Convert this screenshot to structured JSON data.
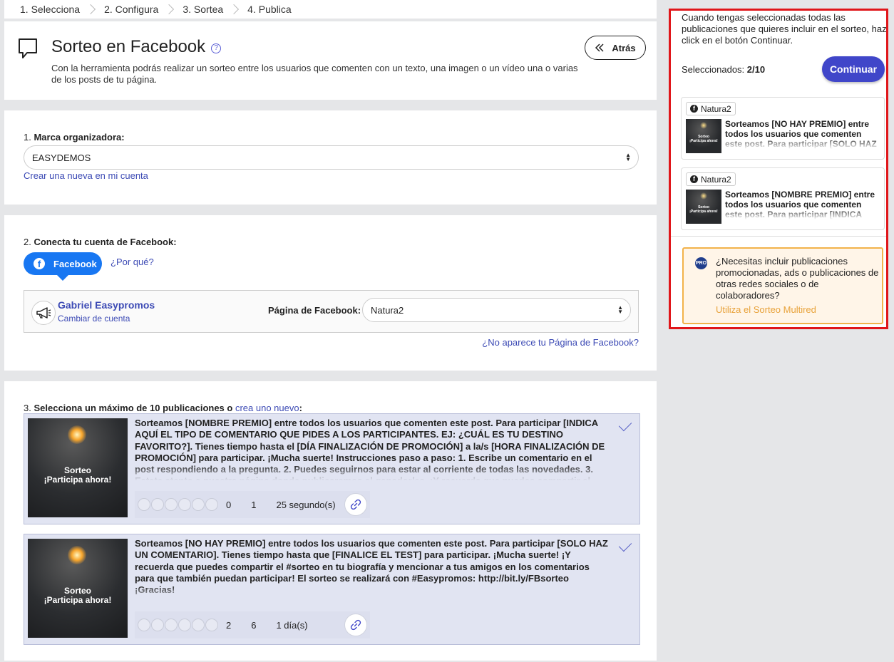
{
  "stepper": {
    "steps": [
      "1. Selecciona",
      "2. Configura",
      "3. Sortea",
      "4. Publica"
    ]
  },
  "header": {
    "title": "Sorteo en Facebook",
    "help_icon": "question-circle-icon",
    "description": "Con la herramienta podrás realizar un sorteo entre los usuarios que comenten con un texto, una imagen o un vídeo una o varias de los posts de tu página.",
    "back_label": "Atrás"
  },
  "brand": {
    "label_num": "1.",
    "label": "Marca organizadora:",
    "selected": "EASYDEMOS",
    "create_link": "Crear una nueva en mi cuenta"
  },
  "facebook": {
    "label_num": "2.",
    "label": "Conecta tu cuenta de Facebook:",
    "button_label": "Facebook",
    "why_link": "¿Por qué?",
    "account_name": "Gabriel Easypromos",
    "change_account": "Cambiar de cuenta",
    "page_label": "Página de Facebook:",
    "page_selected": "Natura2",
    "missing_page_link": "¿No aparece tu Página de Facebook?"
  },
  "posts_section": {
    "label_num": "3.",
    "label_pre": "Selecciona un máximo de 10 publicaciones o",
    "label_link": "crea uno nuevo",
    "label_post": ":",
    "posts": [
      {
        "thumb_line1": "Sorteo",
        "thumb_line2": "¡Participa ahora!",
        "text": "Sorteamos [NOMBRE PREMIO] entre todos los usuarios que comenten este post. Para participar [INDICA AQUÍ EL TIPO DE COMENTARIO QUE PIDES A LOS PARTICIPANTES. EJ: ¿CUÁL ES TU DESTINO FAVORITO?]. Tienes tiempo hasta el [DÍA FINALIZACIÓN DE PROMOCIÓN] a la/s [HORA FINALIZACIÓN DE PROMOCIÓN] para participar. ¡Mucha suerte! Instrucciones paso a paso: 1. Escribe un comentario en el post respondiendo a la pregunta. 2. Puedes seguirnos para estar al corriente de todas las novedades. 3. Estate atento a nuestra página donde publicaremos al ganador/es. ¡Y recuerda que puedes compartir el",
        "reactions": "0",
        "comments": "1",
        "time": "25 segundo(s)"
      },
      {
        "thumb_line1": "Sorteo",
        "thumb_line2": "¡Participa ahora!",
        "text": "Sorteamos [NO HAY PREMIO] entre todos los usuarios que comenten este post. Para participar [SOLO HAZ UN COMENTARIO]. Tienes tiempo hasta que [FINALICE EL TEST] para participar. ¡Mucha suerte! ¡Y recuerda que puedes compartir el #sorteo en tu biografía y mencionar a tus amigos en los comentarios para que también puedan participar! El sorteo se realizará con #Easypromos: http://bit.ly/FBsorteo ¡Gracias!",
        "reactions": "2",
        "comments": "6",
        "time": "1 día(s)"
      }
    ]
  },
  "sidebar": {
    "info": "Cuando tengas seleccionadas todas las publicaciones que quieres incluir en el sorteo, haz click en el botón Continuar.",
    "selected_label": "Seleccionados:",
    "selected_count": "2/10",
    "continue_label": "Continuar",
    "cards": [
      {
        "page": "Natura2",
        "thumb_line1": "Sorteo",
        "thumb_line2": "¡Participa ahora!",
        "text": "Sorteamos [NO HAY PREMIO] entre todos los usuarios que comenten este post. Para participar [SOLO HAZ UN COMENTARIO]. Ti..."
      },
      {
        "page": "Natura2",
        "thumb_line1": "Sorteo",
        "thumb_line2": "¡Participa ahora!",
        "text": "Sorteamos [NOMBRE PREMIO] entre todos los usuarios que comenten este post. Para participar [INDICA AQUÍ EL TIPO DE COMENTARIO"
      }
    ],
    "pro_badge": "PRO",
    "pro_text": "¿Necesitas incluir publicaciones promocionadas, ads o publicaciones de otras redes sociales o de colaboradores?",
    "pro_link": "Utiliza el Sorteo Multired"
  },
  "colors": {
    "accent": "#4046c9",
    "facebook": "#1877f2",
    "link": "#3d4bb5",
    "highlight_border": "#e0161a",
    "pro_border": "#f2b24a"
  }
}
